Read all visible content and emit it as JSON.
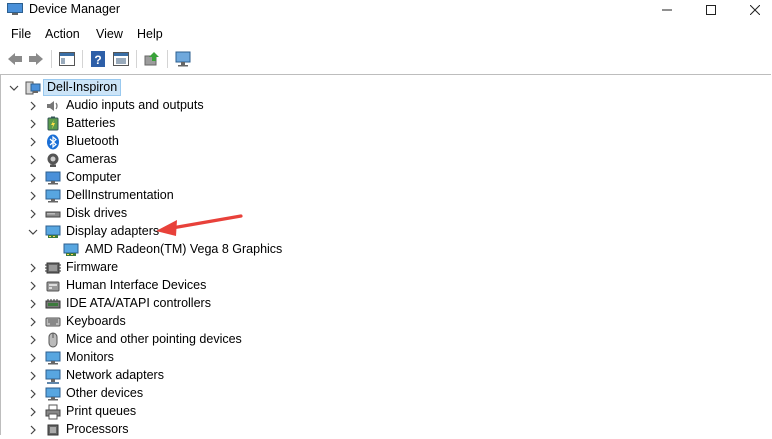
{
  "window": {
    "title": "Device Manager"
  },
  "menu": [
    "File",
    "Action",
    "View",
    "Help"
  ],
  "toolbar_icons": [
    "back-icon",
    "forward-icon",
    "properties-icon",
    "help-icon",
    "view-icon",
    "update-driver-icon",
    "scan-hardware-icon"
  ],
  "tree": {
    "root": "Dell-Inspiron",
    "categories": [
      {
        "label": "Audio inputs and outputs",
        "icon": "speaker-icon",
        "expanded": false
      },
      {
        "label": "Batteries",
        "icon": "battery-icon",
        "expanded": false
      },
      {
        "label": "Bluetooth",
        "icon": "bluetooth-icon",
        "expanded": false
      },
      {
        "label": "Cameras",
        "icon": "camera-icon",
        "expanded": false
      },
      {
        "label": "Computer",
        "icon": "computer-icon",
        "expanded": false
      },
      {
        "label": "DellInstrumentation",
        "icon": "monitor-icon",
        "expanded": false
      },
      {
        "label": "Disk drives",
        "icon": "disk-drive-icon",
        "expanded": false
      },
      {
        "label": "Display adapters",
        "icon": "display-adapter-icon",
        "expanded": true,
        "children": [
          "AMD Radeon(TM) Vega 8 Graphics"
        ]
      },
      {
        "label": "Firmware",
        "icon": "firmware-icon",
        "expanded": false
      },
      {
        "label": "Human Interface Devices",
        "icon": "hid-icon",
        "expanded": false
      },
      {
        "label": "IDE ATA/ATAPI controllers",
        "icon": "ide-controller-icon",
        "expanded": false
      },
      {
        "label": "Keyboards",
        "icon": "keyboard-icon",
        "expanded": false
      },
      {
        "label": "Mice and other pointing devices",
        "icon": "mouse-icon",
        "expanded": false
      },
      {
        "label": "Monitors",
        "icon": "monitor-icon",
        "expanded": false
      },
      {
        "label": "Network adapters",
        "icon": "network-icon",
        "expanded": false
      },
      {
        "label": "Other devices",
        "icon": "other-devices-icon",
        "expanded": false
      },
      {
        "label": "Print queues",
        "icon": "printer-icon",
        "expanded": false
      },
      {
        "label": "Processors",
        "icon": "processor-icon",
        "expanded": false
      }
    ]
  },
  "annotation_arrow": {
    "color": "#e8413a",
    "points_to": "Display adapters"
  }
}
